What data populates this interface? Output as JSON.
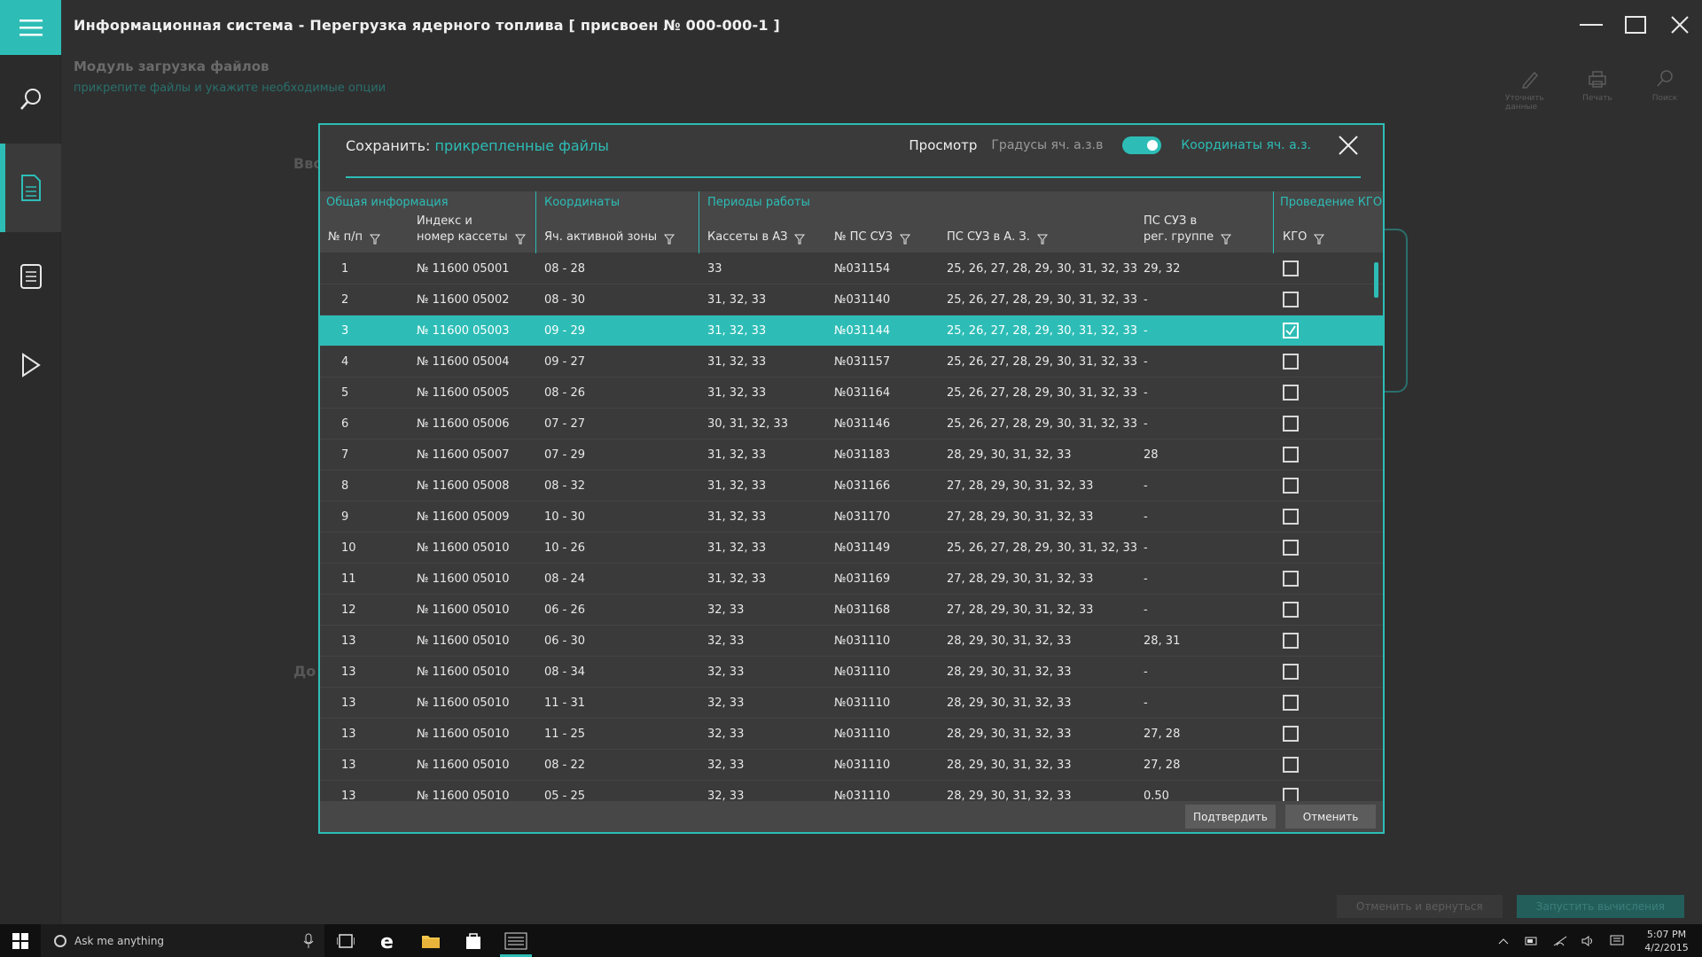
{
  "window": {
    "title": "Информационная система - Перегрузка ядерного топлива [ присвоен № 000-000-1 ]"
  },
  "module": {
    "heading": "Модуль загрузка файлов",
    "subheading": "прикрепите файлы и укажите необходимые опции"
  },
  "top_tools": [
    {
      "label": "Уточнить данные",
      "icon": "pencil-icon"
    },
    {
      "label": "Печать",
      "icon": "printer-icon"
    },
    {
      "label": "Поиск",
      "icon": "search-icon"
    }
  ],
  "background": {
    "label1": "Вво",
    "label2": "До"
  },
  "bottom_actions": {
    "cancel_return": "Отменить и вернуться",
    "run": "Запустить вычисления"
  },
  "dialog": {
    "save_prefix": "Сохранить:",
    "save_accent": "прикрепленные файлы",
    "view": "Просмотр",
    "degrees": "Градусы яч. а.з.в",
    "toggle_on": true,
    "coords": "Координаты яч. а.з.",
    "confirm": "Подтвердить",
    "cancel": "Отменить"
  },
  "table": {
    "groups": {
      "general": "Общая информация",
      "coords": "Координаты",
      "periods": "Периоды работы",
      "kgo": "Проведение КГО"
    },
    "columns": {
      "num_a": "№ п/п",
      "index_1": "Индекс и",
      "index_2": "номер кассеты",
      "cell": "Яч. активной зоны",
      "cassettes": "Кассеты в АЗ",
      "ps_num": "№ ПС СУЗ",
      "ps_az": "ПС СУЗ в А. З.",
      "ps_reg_1": "ПС СУЗ в",
      "ps_reg_2": "рег. группе",
      "kgo": "КГО"
    },
    "rows": [
      {
        "n": "1",
        "idx": "№ 11600 05001",
        "cell": "08 - 28",
        "cas": "33",
        "ps": "№031154",
        "psaz": "25, 26, 27, 28, 29, 30, 31, 32, 33",
        "reg": "29, 32",
        "kgo": false
      },
      {
        "n": "2",
        "idx": "№ 11600 05002",
        "cell": "08 - 30",
        "cas": "31, 32, 33",
        "ps": "№031140",
        "psaz": "25, 26, 27, 28, 29, 30, 31, 32, 33",
        "reg": "-",
        "kgo": false
      },
      {
        "n": "3",
        "idx": "№ 11600 05003",
        "cell": "09 - 29",
        "cas": "31, 32, 33",
        "ps": "№031144",
        "psaz": "25, 26, 27, 28, 29, 30, 31, 32, 33",
        "reg": "-",
        "kgo": true,
        "selected": true
      },
      {
        "n": "4",
        "idx": "№ 11600 05004",
        "cell": "09 - 27",
        "cas": "31, 32, 33",
        "ps": "№031157",
        "psaz": "25, 26, 27, 28, 29, 30, 31, 32, 33",
        "reg": "-",
        "kgo": false
      },
      {
        "n": "5",
        "idx": "№ 11600 05005",
        "cell": "08 - 26",
        "cas": "31, 32, 33",
        "ps": "№031164",
        "psaz": "25, 26, 27, 28, 29, 30, 31, 32, 33",
        "reg": "-",
        "kgo": false
      },
      {
        "n": "6",
        "idx": "№ 11600 05006",
        "cell": "07 - 27",
        "cas": "30, 31, 32, 33",
        "ps": "№031146",
        "psaz": "25, 26, 27, 28, 29, 30, 31, 32, 33",
        "reg": "-",
        "kgo": false
      },
      {
        "n": "7",
        "idx": "№ 11600 05007",
        "cell": "07 - 29",
        "cas": "31, 32, 33",
        "ps": "№031183",
        "psaz": "28, 29, 30, 31, 32, 33",
        "reg": "28",
        "kgo": false
      },
      {
        "n": "8",
        "idx": "№ 11600 05008",
        "cell": "08 - 32",
        "cas": "31, 32, 33",
        "ps": "№031166",
        "psaz": "27, 28, 29, 30, 31, 32, 33",
        "reg": "-",
        "kgo": false
      },
      {
        "n": "9",
        "idx": "№ 11600 05009",
        "cell": "10 - 30",
        "cas": "31, 32, 33",
        "ps": "№031170",
        "psaz": "27, 28, 29, 30, 31, 32, 33",
        "reg": "-",
        "kgo": false
      },
      {
        "n": "10",
        "idx": "№ 11600 05010",
        "cell": "10 - 26",
        "cas": "31, 32, 33",
        "ps": "№031149",
        "psaz": "25, 26, 27, 28, 29, 30, 31, 32, 33",
        "reg": "-",
        "kgo": false
      },
      {
        "n": "11",
        "idx": "№ 11600 05010",
        "cell": "08 - 24",
        "cas": "31, 32, 33",
        "ps": "№031169",
        "psaz": "27, 28, 29, 30, 31, 32, 33",
        "reg": "-",
        "kgo": false
      },
      {
        "n": "12",
        "idx": "№ 11600 05010",
        "cell": "06 - 26",
        "cas": "32, 33",
        "ps": "№031168",
        "psaz": "27, 28, 29, 30, 31, 32, 33",
        "reg": "-",
        "kgo": false
      },
      {
        "n": "13",
        "idx": "№ 11600 05010",
        "cell": "06 - 30",
        "cas": "32, 33",
        "ps": "№031110",
        "psaz": "28, 29, 30, 31, 32, 33",
        "reg": "28, 31",
        "kgo": false
      },
      {
        "n": "13",
        "idx": "№ 11600 05010",
        "cell": "08 - 34",
        "cas": "32, 33",
        "ps": "№031110",
        "psaz": "28, 29, 30, 31, 32, 33",
        "reg": "-",
        "kgo": false
      },
      {
        "n": "13",
        "idx": "№ 11600 05010",
        "cell": "11 - 31",
        "cas": "32, 33",
        "ps": "№031110",
        "psaz": "28, 29, 30, 31, 32, 33",
        "reg": "-",
        "kgo": false
      },
      {
        "n": "13",
        "idx": "№ 11600 05010",
        "cell": "11 - 25",
        "cas": "32, 33",
        "ps": "№031110",
        "psaz": "28, 29, 30, 31, 32, 33",
        "reg": "27, 28",
        "kgo": false
      },
      {
        "n": "13",
        "idx": "№ 11600 05010",
        "cell": "08 - 22",
        "cas": "32, 33",
        "ps": "№031110",
        "psaz": "28, 29, 30, 31, 32, 33",
        "reg": "27, 28",
        "kgo": false
      },
      {
        "n": "13",
        "idx": "№ 11600 05010",
        "cell": "05 - 25",
        "cas": "32, 33",
        "ps": "№031110",
        "psaz": "28, 29, 30, 31, 32, 33",
        "reg": "0.50",
        "kgo": false
      }
    ]
  },
  "taskbar": {
    "search_placeholder": "Ask me anything",
    "time": "5:07 PM",
    "date": "4/2/2015"
  },
  "colors": {
    "accent": "#2dbdb6",
    "background": "#2f2f2f",
    "dialog": "#3a3a3a"
  }
}
